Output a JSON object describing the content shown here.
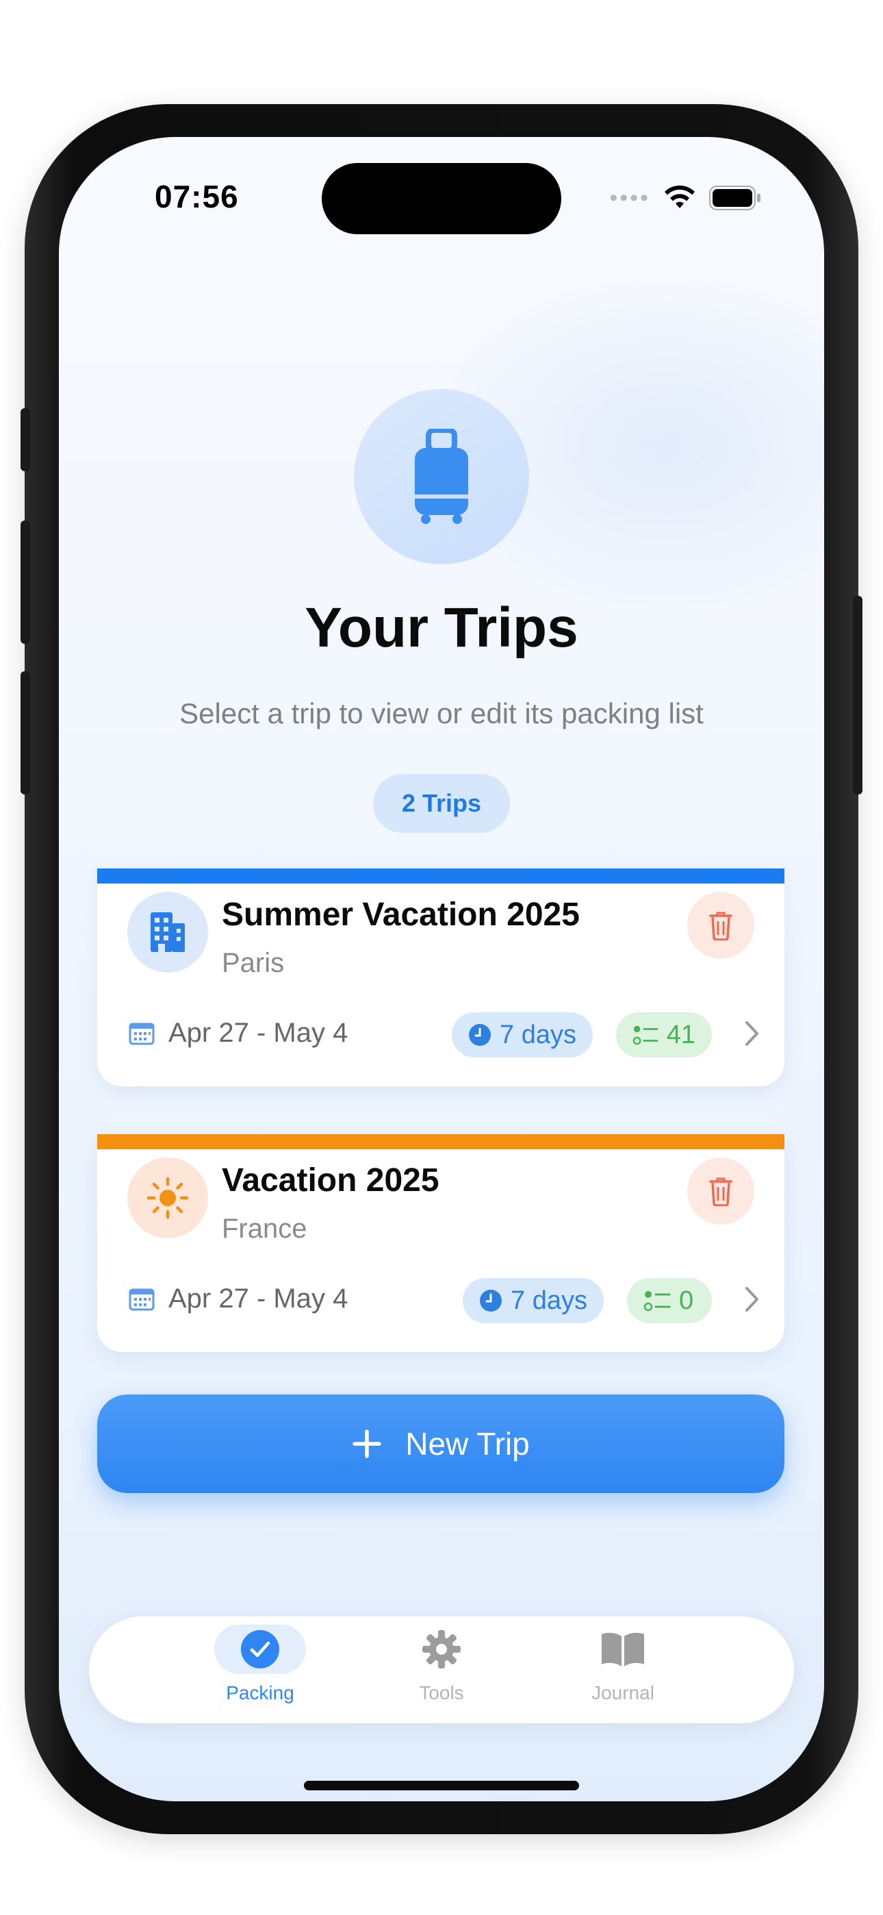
{
  "status_bar": {
    "time": "07:56"
  },
  "header": {
    "title": "Your Trips",
    "subtitle": "Select a trip to view or edit its packing list",
    "trip_count": "2 Trips"
  },
  "trips": [
    {
      "name": "Summer Vacation 2025",
      "location": "Paris",
      "dates": "Apr 27 - May 4",
      "duration": "7 days",
      "items": "41",
      "accent": "#1a7cf0",
      "icon": "building-icon"
    },
    {
      "name": "Vacation 2025",
      "location": "France",
      "dates": "Apr 27 - May 4",
      "duration": "7 days",
      "items": "0",
      "accent": "#f5900e",
      "icon": "sun-icon"
    }
  ],
  "actions": {
    "new_trip": "New Trip"
  },
  "tabbar": {
    "tabs": [
      {
        "label": "Packing",
        "icon": "checkmark-circle-icon",
        "active": true
      },
      {
        "label": "Tools",
        "icon": "gear-icon",
        "active": false
      },
      {
        "label": "Journal",
        "icon": "book-icon",
        "active": false
      }
    ]
  },
  "colors": {
    "accent": "#2f86f2",
    "delete": "#ef6a4e",
    "success": "#4caf5c"
  }
}
